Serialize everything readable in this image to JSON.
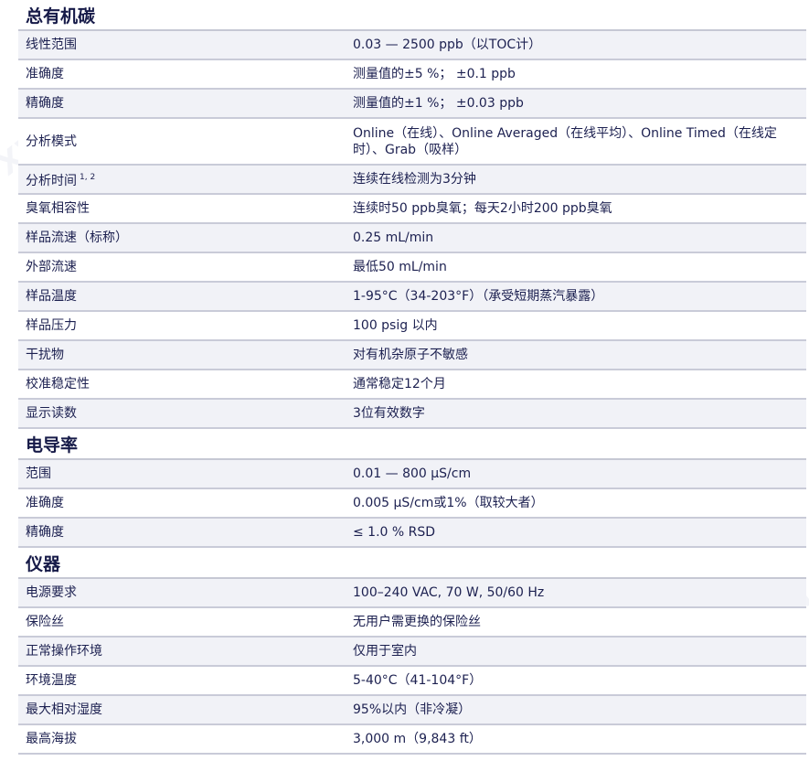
{
  "watermark": "xwboo.com",
  "sections": [
    {
      "title": "总有机碳",
      "rows": [
        {
          "label": "线性范围",
          "value": "0.03 — 2500 ppb（以TOC计）"
        },
        {
          "label": "准确度",
          "value": "测量值的±5 %； ±0.1 ppb"
        },
        {
          "label": "精确度",
          "value": "测量值的±1 %； ±0.03 ppb"
        },
        {
          "label": "分析模式",
          "value": "Online（在线）、Online Averaged（在线平均）、Online Timed（在线定时）、Grab（吸样）"
        },
        {
          "label": "分析时间",
          "sup": "1, 2",
          "value": "连续在线检测为3分钟"
        },
        {
          "label": "臭氧相容性",
          "value": "连续时50 ppb臭氧；每天2小时200 ppb臭氧"
        },
        {
          "label": "样品流速（标称）",
          "value": "0.25 mL/min"
        },
        {
          "label": "外部流速",
          "value": "最低50 mL/min"
        },
        {
          "label": "样品温度",
          "value": "1-95°C（34-203°F）（承受短期蒸汽暴露）"
        },
        {
          "label": "样品压力",
          "value": "100 psig 以内"
        },
        {
          "label": "干扰物",
          "value": "对有机杂原子不敏感"
        },
        {
          "label": "校准稳定性",
          "value": "通常稳定12个月"
        },
        {
          "label": "显示读数",
          "value": "3位有效数字"
        }
      ]
    },
    {
      "title": "电导率",
      "rows": [
        {
          "label": "范围",
          "value": "0.01 — 800 μS/cm"
        },
        {
          "label": "准确度",
          "value": "0.005 μS/cm或1%（取较大者）"
        },
        {
          "label": "精确度",
          "value": "≤ 1.0 % RSD"
        }
      ]
    },
    {
      "title": "仪器",
      "rows": [
        {
          "label": "电源要求",
          "value": "100–240 VAC, 70 W, 50/60 Hz"
        },
        {
          "label": "保险丝",
          "value": "无用户需更换的保险丝"
        },
        {
          "label": "正常操作环境",
          "value": "仅用于室内"
        },
        {
          "label": "环境温度",
          "value": "5-40°C（41-104°F）"
        },
        {
          "label": "最大相对湿度",
          "value": "95%以内（非冷凝）"
        },
        {
          "label": "最高海拔",
          "value": "3,000 m（9,843 ft）"
        }
      ]
    }
  ]
}
